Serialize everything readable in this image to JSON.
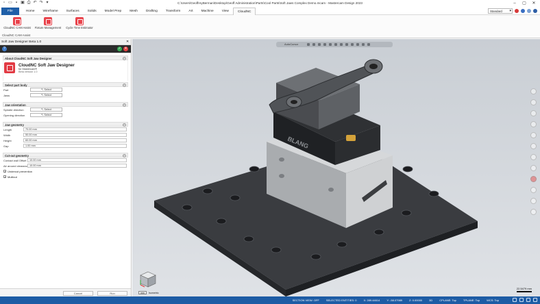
{
  "window": {
    "title": "C:\\Users\\GeoffreyBerman\\Desktop\\Geoff Administration\\Parts\\Cool Parts\\Soft Jaws Complex Demo.mcam - Mastercam Design 2023"
  },
  "menu": {
    "tabs": [
      "File",
      "Home",
      "Wireframe",
      "Surfaces",
      "Solids",
      "Model Prep",
      "Mesh",
      "Drafting",
      "Transform",
      "Art",
      "Machine",
      "View",
      "CloudNC"
    ],
    "active": "CloudNC",
    "mode_select": "Standard"
  },
  "ribbon": {
    "buttons": [
      {
        "label": "CloudNC CAM Assist"
      },
      {
        "label": "Fixture Management"
      },
      {
        "label": "Cycle Time Estimator"
      }
    ],
    "group_label": "CloudNC CAM Assist"
  },
  "panel": {
    "title": "Soft Jaw Designer Beta 1.0",
    "about_section": "About CloudNC Soft Jaw Designer",
    "product_name": "CloudNC Soft Jaw Designer",
    "product_sub": "for Mastercam®",
    "product_version": "Beta version 1.0",
    "select_part_body": {
      "heading": "Select part body",
      "rows": [
        {
          "label": "Part",
          "button": "Select"
        },
        {
          "label": "Jaws",
          "button": "Select"
        }
      ]
    },
    "jaw_orientation": {
      "heading": "Jaw orientation",
      "rows": [
        {
          "label": "Spindle direction",
          "button": "Select"
        },
        {
          "label": "Opening direction",
          "button": "Select"
        }
      ]
    },
    "jaw_geometry": {
      "heading": "Jaw geometry",
      "rows": [
        {
          "label": "Length",
          "value": "70.00 mm"
        },
        {
          "label": "Width",
          "value": "50.00 mm"
        },
        {
          "label": "Height",
          "value": "60.00 mm"
        },
        {
          "label": "Gap",
          "value": "1.00 mm"
        }
      ]
    },
    "cut_out_geometry": {
      "heading": "Cut-out geometry",
      "rows": [
        {
          "label": "Contact wall Offset",
          "value": "10.00 mm"
        },
        {
          "label": "Air around clearance",
          "value": "10.00 mm"
        }
      ]
    },
    "checkboxes": [
      {
        "label": "Undercut prevention",
        "checked": true
      },
      {
        "label": "Multicut",
        "checked": true
      }
    ],
    "footer": {
      "cancel": "Cancel",
      "run": "Run"
    }
  },
  "viewport": {
    "toolbar_label": "AutoCursor",
    "zoom_label": "22.5479 mm",
    "view_label": "Isometric",
    "view_unit": "mm",
    "part_text": "BLANG"
  },
  "status": {
    "items": [
      "SECTION VIEW: OFF",
      "SELECTED ENTITIES: 0",
      "X: 289.44614",
      "Y: -58.07989",
      "Z: 0.00000",
      "3D",
      "CPLANE: Top",
      "TPLANE: Top",
      "WCS: Top"
    ]
  },
  "colors": {
    "accent": "#1f5fa8",
    "brand_red": "#e23b44",
    "status_bar": "#1d5ca5"
  }
}
